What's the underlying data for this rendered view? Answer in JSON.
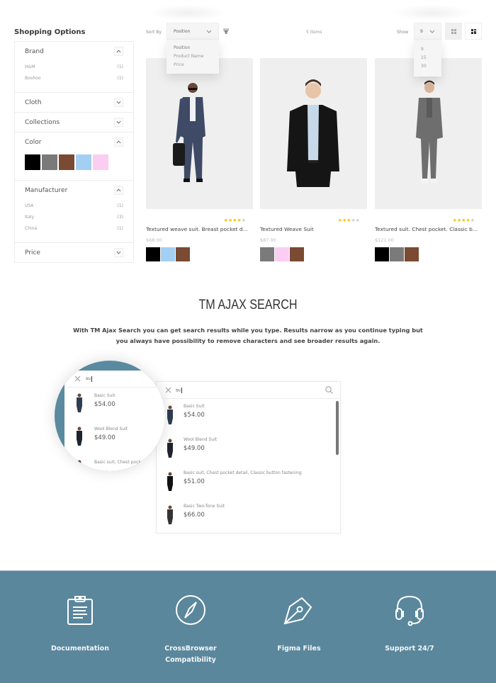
{
  "sidebar": {
    "title": "Shopping Options",
    "filters": {
      "brand": {
        "label": "Brand",
        "expanded": true,
        "items": [
          {
            "name": "H&M",
            "count": "(1)"
          },
          {
            "name": "Boohoo",
            "count": "(1)"
          }
        ]
      },
      "cloth": {
        "label": "Cloth",
        "expanded": false
      },
      "collections": {
        "label": "Collections",
        "expanded": false
      },
      "color": {
        "label": "Color",
        "expanded": true,
        "swatches": [
          "#000000",
          "#7a7a7a",
          "#7a4a33",
          "#a3cff2",
          "#fbcdf3"
        ]
      },
      "manufacturer": {
        "label": "Manufacturer",
        "expanded": true,
        "items": [
          {
            "name": "USA",
            "count": "(1)"
          },
          {
            "name": "Italy",
            "count": "(3)"
          },
          {
            "name": "China",
            "count": "(1)"
          }
        ]
      },
      "price": {
        "label": "Price",
        "expanded": false
      }
    }
  },
  "toolbar": {
    "sort_label": "Sort By",
    "sort_value": "Position",
    "sort_options": [
      "Position",
      "Product Name",
      "Price"
    ],
    "items_count": "5 Items",
    "show_label": "Show",
    "show_value": "9",
    "show_options": [
      "9",
      "15",
      "30"
    ]
  },
  "products": [
    {
      "name": "Textured weave suit. Breast pocket d...",
      "price": "$68.00",
      "rating": 4,
      "max_rating": 5,
      "swatches": [
        "#000000",
        "#a3cff2",
        "#7a4a33"
      ]
    },
    {
      "name": "Textured Weave Suit",
      "price": "$87.00",
      "rating": 3,
      "max_rating": 5,
      "swatches": [
        "#7a7a7a",
        "#fbcdf3",
        "#7a4a33"
      ]
    },
    {
      "name": "Textured suit. Chest pocket. Classic b...",
      "price": "$121.00",
      "rating": 4,
      "max_rating": 5,
      "swatches": [
        "#000000",
        "#7a7a7a",
        "#7a4a33"
      ]
    }
  ],
  "ajax": {
    "title": "TM AJAX SEARCH",
    "description": "With TM Ajax Search you can get search results while you type. Results narrow as you continue typing but you always have possibility to remove characters and see broader results again.",
    "query": "su",
    "results": [
      {
        "name": "Basic Suit",
        "price": "$54.00"
      },
      {
        "name": "Wool Blend Suit",
        "price": "$49.00"
      },
      {
        "name": "Basic suit, Chest pocket detail, Classic button fastening",
        "price": "$51.00"
      },
      {
        "name": "Basic Two-Tone Suit",
        "price": "$66.00"
      }
    ],
    "magnified_partial_name": "Basic suit, Chest pock"
  },
  "features": [
    {
      "icon": "clipboard-icon",
      "label": "Documentation"
    },
    {
      "icon": "compass-icon",
      "label": "CrossBrowser Compatibility"
    },
    {
      "icon": "pen-nib-icon",
      "label": "Figma Files"
    },
    {
      "icon": "headset-icon",
      "label": "Support 24/7"
    }
  ],
  "colors": {
    "accent": "#5a879c",
    "star": "#f4c20d"
  }
}
